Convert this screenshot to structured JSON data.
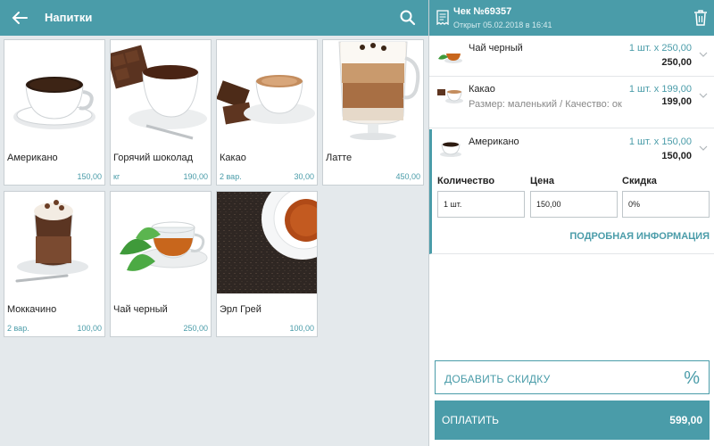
{
  "category": {
    "title": "Напитки"
  },
  "products": [
    {
      "name": "Американо",
      "sub": "",
      "price": "150,00",
      "image": "coffee-cup"
    },
    {
      "name": "Горячий шоколад",
      "sub": "кг",
      "price": "190,00",
      "image": "hot-chocolate"
    },
    {
      "name": "Какао",
      "sub": "2 вар.",
      "price": "30,00",
      "image": "cocoa"
    },
    {
      "name": "Латте",
      "sub": "",
      "price": "450,00",
      "image": "latte-glass"
    },
    {
      "name": "Моккачино",
      "sub": "2 вар.",
      "price": "100,00",
      "image": "mochaccino"
    },
    {
      "name": "Чай черный",
      "sub": "",
      "price": "250,00",
      "image": "black-tea"
    },
    {
      "name": "Эрл Грей",
      "sub": "",
      "price": "100,00",
      "image": "earl-grey"
    }
  ],
  "receipt": {
    "title": "Чек №69357",
    "opened": "Открыт 05.02.2018 в 16:41",
    "lines": [
      {
        "name": "Чай черный",
        "modifiers": "",
        "qty_price": "1 шт. x 250,00",
        "total": "250,00"
      },
      {
        "name": "Какао",
        "modifiers": "Размер: маленький / Качество: ок",
        "qty_price": "1 шт. x 199,00",
        "total": "199,00"
      },
      {
        "name": "Американо",
        "modifiers": "",
        "qty_price": "1 шт. x 150,00",
        "total": "150,00"
      }
    ],
    "editor": {
      "quantity_label": "Количество",
      "quantity_value": "1 шт.",
      "price_label": "Цена",
      "price_value": "150,00",
      "discount_label": "Скидка",
      "discount_value": "0%",
      "details_link": "ПОДРОБНАЯ ИНФОРМАЦИЯ"
    },
    "add_discount_label": "ДОБАВИТЬ СКИДКУ",
    "add_discount_icon": "%",
    "pay_label": "ОПЛАТИТЬ",
    "pay_total": "599,00"
  },
  "colors": {
    "accent": "#4a9ca9",
    "background": "#e4e9ec"
  }
}
